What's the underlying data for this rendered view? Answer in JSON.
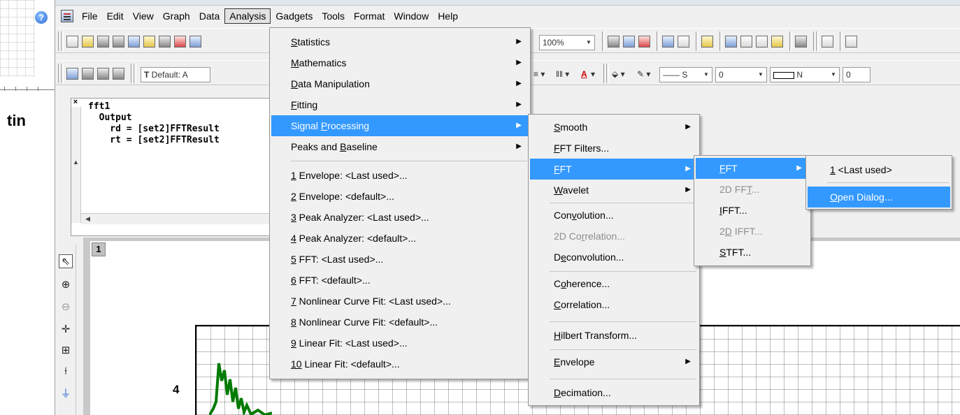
{
  "background_text": "tin",
  "menubar": {
    "items": [
      "File",
      "Edit",
      "View",
      "Graph",
      "Data",
      "Analysis",
      "Gadgets",
      "Tools",
      "Format",
      "Window",
      "Help"
    ],
    "active": "Analysis"
  },
  "toolbar": {
    "zoom": "100%",
    "font_combo": "Default: A",
    "line_combo": "S",
    "size_value": "0",
    "n_combo": "N",
    "n_value": "0"
  },
  "script_window": {
    "lines": [
      "fft1",
      "  Output",
      "    rd = [set2]FFTResult",
      "    rt = [set2]FFTResult"
    ]
  },
  "graph": {
    "layer": "1",
    "y_tick": "4"
  },
  "analysis_menu": [
    {
      "label": "Statistics",
      "u": "S",
      "sub": true
    },
    {
      "label": "Mathematics",
      "u": "M",
      "sub": true
    },
    {
      "label": "Data Manipulation",
      "u": "D",
      "sub": true
    },
    {
      "label": "Fitting",
      "u": "F",
      "sub": true
    },
    {
      "label": "Signal Processing",
      "u": "P",
      "sub": true
    },
    {
      "label": "Peaks and Baseline",
      "u": "B",
      "sub": true
    },
    {
      "label": "1 Envelope: <Last used>...",
      "u": "1"
    },
    {
      "label": "2 Envelope: <default>...",
      "u": "2"
    },
    {
      "label": "3 Peak Analyzer: <Last used>...",
      "u": "3"
    },
    {
      "label": "4 Peak Analyzer: <default>...",
      "u": "4"
    },
    {
      "label": "5 FFT: <Last used>...",
      "u": "5"
    },
    {
      "label": "6 FFT: <default>...",
      "u": "6"
    },
    {
      "label": "7 Nonlinear Curve Fit: <Last used>...",
      "u": "7"
    },
    {
      "label": "8 Nonlinear Curve Fit: <default>...",
      "u": "8"
    },
    {
      "label": "9 Linear Fit: <Last used>...",
      "u": "9"
    },
    {
      "label": "10 Linear Fit: <default>...",
      "u": "10"
    }
  ],
  "signal_menu": [
    {
      "label": "Smooth",
      "u": "S",
      "sub": true
    },
    {
      "label": "FFT Filters...",
      "u": "F"
    },
    {
      "label": "FFT",
      "u": "F",
      "sub": true
    },
    {
      "label": "Wavelet",
      "u": "W",
      "sub": true
    },
    {
      "label": "Convolution...",
      "u": "v"
    },
    {
      "label": "2D Correlation...",
      "u": "r",
      "disabled": true
    },
    {
      "label": "Deconvolution...",
      "u": "e"
    },
    {
      "label": "Coherence...",
      "u": "o"
    },
    {
      "label": "Correlation...",
      "u": "C"
    },
    {
      "label": "Hilbert Transform...",
      "u": "H"
    },
    {
      "label": "Envelope",
      "u": "E",
      "sub": true
    },
    {
      "label": "Decimation...",
      "u": "D"
    }
  ],
  "fft_menu": [
    {
      "label": "FFT",
      "u": "F",
      "sub": true
    },
    {
      "label": "2D FFT...",
      "u": "T",
      "disabled": true
    },
    {
      "label": "IFFT...",
      "u": "I"
    },
    {
      "label": "2D IFFT...",
      "u": "D",
      "disabled": true
    },
    {
      "label": "STFT...",
      "u": "S"
    }
  ],
  "fft_sub_menu": [
    {
      "label": "1 <Last used>",
      "u": "1"
    },
    {
      "label": "Open Dialog...",
      "u": "O"
    }
  ]
}
